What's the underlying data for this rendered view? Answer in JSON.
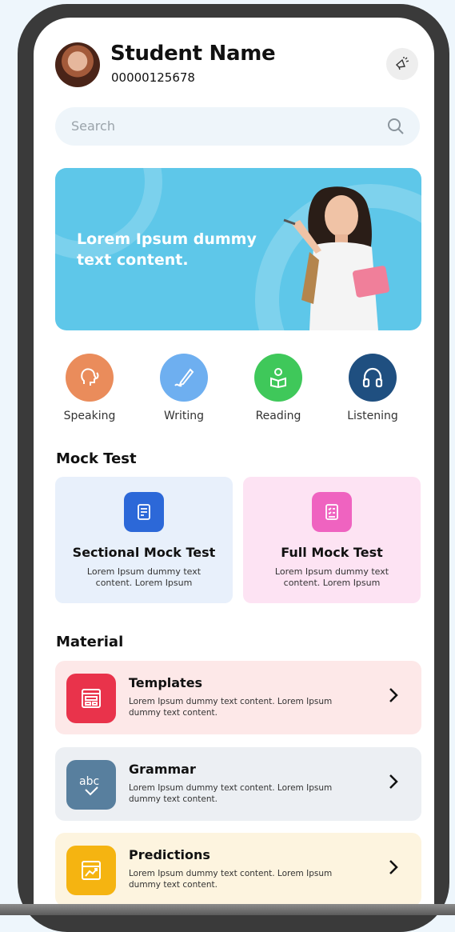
{
  "profile": {
    "name": "Student Name",
    "id": "00000125678"
  },
  "search": {
    "placeholder": "Search"
  },
  "banner": {
    "text": "Lorem Ipsum dummy text content."
  },
  "skills": [
    {
      "label": "Speaking",
      "icon": "speaking-head-icon",
      "color": "#ea8c5b"
    },
    {
      "label": "Writing",
      "icon": "pen-icon",
      "color": "#6eaff0"
    },
    {
      "label": "Reading",
      "icon": "reading-person-icon",
      "color": "#3fc85a"
    },
    {
      "label": "Listening",
      "icon": "headphones-icon",
      "color": "#1f4f80"
    }
  ],
  "mock_test": {
    "heading": "Mock Test",
    "cards": [
      {
        "title": "Sectional Mock Test",
        "desc": "Lorem Ipsum dummy text content. Lorem Ipsum",
        "bg": "#e8f0fb",
        "icon_color": "#2c68d8"
      },
      {
        "title": "Full Mock Test",
        "desc": "Lorem Ipsum dummy text content. Lorem Ipsum",
        "bg": "#fde3f3",
        "icon_color": "#ef63c0"
      }
    ]
  },
  "material": {
    "heading": "Material",
    "items": [
      {
        "title": "Templates",
        "desc": "Lorem Ipsum dummy text content. Lorem Ipsum dummy text content.",
        "bg": "#fde8e8",
        "icon_color": "#e9334b",
        "icon": "template-icon"
      },
      {
        "title": "Grammar",
        "desc": "Lorem Ipsum dummy text content. Lorem Ipsum dummy text content.",
        "bg": "#eceff3",
        "icon_color": "#587f9e",
        "icon": "abc-check-icon"
      },
      {
        "title": "Predictions",
        "desc": "Lorem Ipsum dummy text content. Lorem Ipsum dummy text content.",
        "bg": "#fdf4df",
        "icon_color": "#f5b411",
        "icon": "chart-trend-icon"
      }
    ]
  }
}
